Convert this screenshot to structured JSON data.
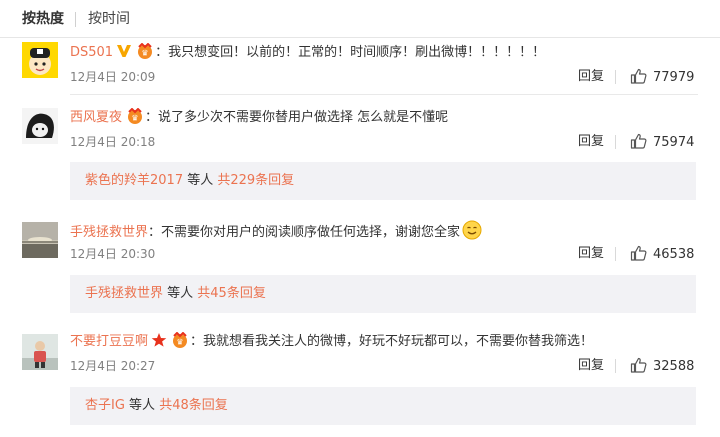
{
  "sort": {
    "hot_label": "按热度",
    "time_label": "按时间"
  },
  "comments": [
    {
      "username": "DS501",
      "separator": "：",
      "text": "我只想变回！以前的！正常的！时间顺序！刷出微博！！！！！！",
      "time": "12月4日 20:09",
      "reply_label": "回复",
      "likes": "77979"
    },
    {
      "username": "西风夏夜",
      "separator": "：",
      "text": "说了多少次不需要你替用户做选择 怎么就是不懂呢",
      "time": "12月4日 20:18",
      "reply_label": "回复",
      "likes": "75974",
      "sub": {
        "user": "紫色的羚羊2017",
        "mid": " 等人 ",
        "count": "共229条回复"
      }
    },
    {
      "username": "手残拯救世界",
      "separator": "：",
      "text": "不需要你对用户的阅读顺序做任何选择，谢谢您全家",
      "time": "12月4日 20:30",
      "reply_label": "回复",
      "likes": "46538",
      "sub": {
        "user": "手残拯救世界",
        "mid": " 等人 ",
        "count": "共45条回复"
      }
    },
    {
      "username": "不要打豆豆啊",
      "separator": "：",
      "text": "我就想看我关注人的微博，好玩不好玩都可以，不需要你替我筛选！",
      "time": "12月4日 20:27",
      "reply_label": "回复",
      "likes": "32588",
      "sub": {
        "user": "杏子IG",
        "mid": " 等人 ",
        "count": "共48条回复"
      }
    }
  ],
  "colors": {
    "link": "#eb7350",
    "muted": "#808080",
    "sub_bg": "#f2f2f5",
    "vip_gold": "#f7a600",
    "star_red": "#e8321d"
  },
  "icons": {
    "verified": "verified-v-icon",
    "member": "member-badge-icon",
    "star": "star-badge-icon",
    "like": "thumbs-up-icon",
    "emoji": "smile-emoji-icon"
  }
}
